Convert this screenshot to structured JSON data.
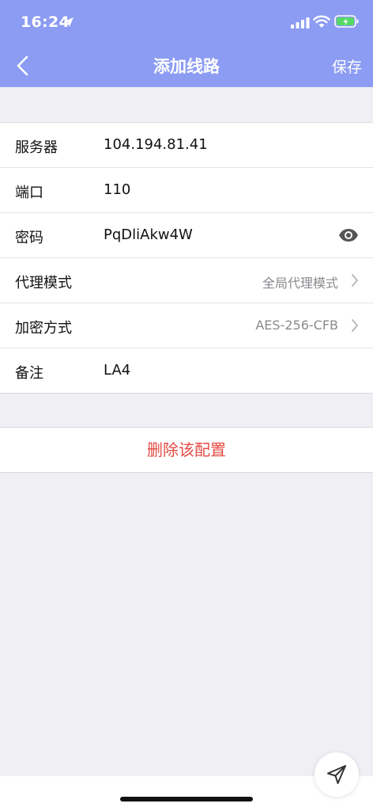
{
  "status_bar": {
    "time": "16:24",
    "icons": [
      "location-arrow-icon",
      "signal-icon",
      "wifi-icon",
      "battery-charging-icon"
    ]
  },
  "nav_bar": {
    "back_icon": "chevron-left-icon",
    "title": "添加线路",
    "save_label": "保存"
  },
  "form": {
    "server": {
      "label": "服务器",
      "value": "104.194.81.41"
    },
    "port": {
      "label": "端口",
      "value": "110"
    },
    "password": {
      "label": "密码",
      "value": "PqDliAkw4W",
      "icon": "eye-icon"
    },
    "proxy_mode": {
      "label": "代理模式",
      "value": "全局代理模式",
      "icon": "chevron-right-icon"
    },
    "encryption": {
      "label": "加密方式",
      "value": "AES-256-CFB",
      "icon": "chevron-right-icon"
    },
    "note": {
      "label": "备注",
      "value": "LA4"
    }
  },
  "delete": {
    "label": "删除该配置"
  },
  "fab": {
    "icon": "send-icon"
  },
  "colors": {
    "nav_bar": "#8c9cf3",
    "background": "#efeff4",
    "delete_text": "#e34a43",
    "secondary_text": "#8a8a8f"
  }
}
